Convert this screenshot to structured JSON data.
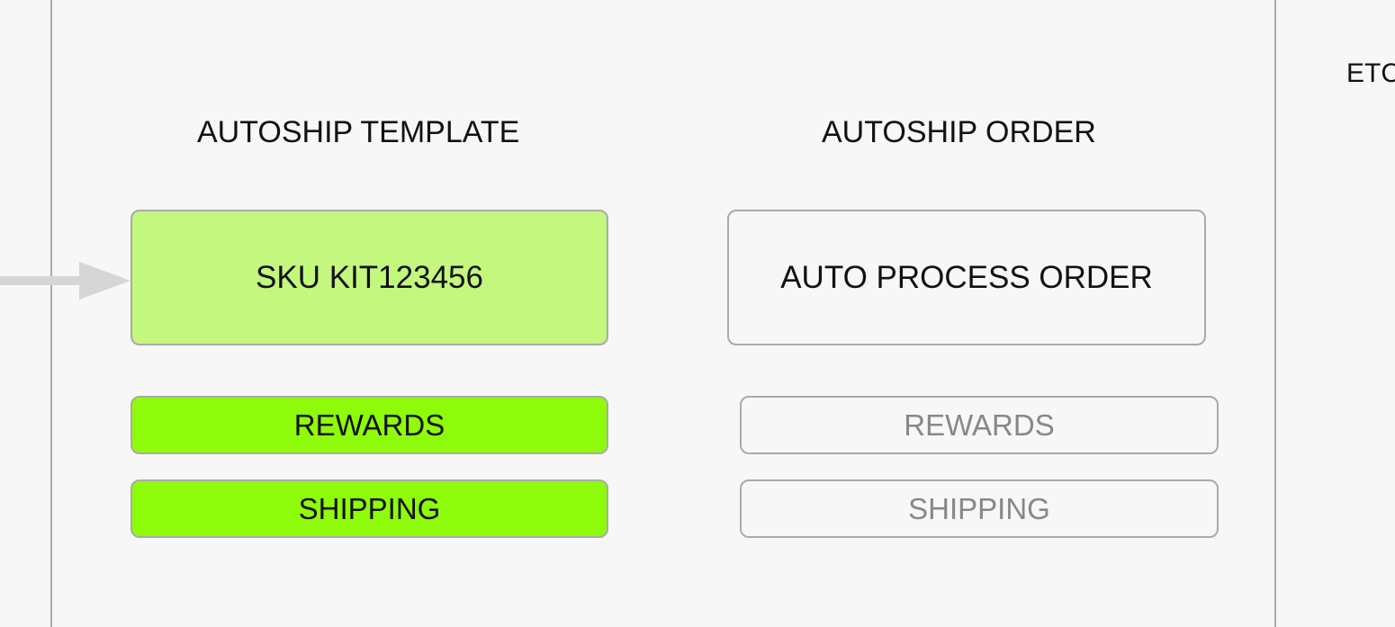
{
  "template_panel": {
    "heading": "AUTOSHIP TEMPLATE",
    "sku_box": "SKU KIT123456",
    "rewards": "REWARDS",
    "shipping": "SHIPPING"
  },
  "order_panel": {
    "heading": "AUTOSHIP ORDER",
    "process_box": "AUTO PROCESS ORDER",
    "rewards": "REWARDS",
    "shipping": "SHIPPING"
  },
  "right_panel": {
    "heading": "ETC"
  },
  "colors": {
    "background": "#f7f7f7",
    "border": "#aaaaaa",
    "sku_fill": "#c4f77e",
    "active_fill": "#8efb0a",
    "muted_text": "#888888",
    "arrow": "#d6d6d6"
  }
}
